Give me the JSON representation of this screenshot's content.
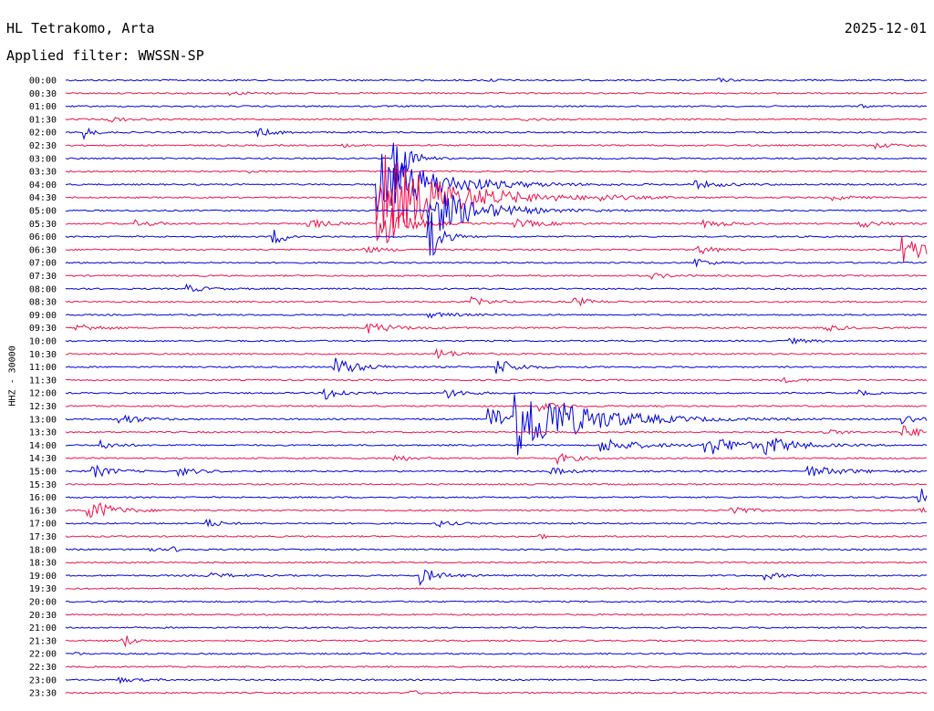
{
  "header": {
    "station": "HL Tetrakomo, Arta",
    "date": "2025-12-01",
    "filter": "Applied filter: WWSSN-SP",
    "channel_scale": "HHZ - 30000"
  },
  "colors": {
    "even": "#0000dd",
    "odd": "#f0104a"
  },
  "chart_data": {
    "type": "line",
    "title": "HL Tetrakomo, Arta",
    "subtitle": "Applied filter: WWSSN-SP",
    "ylabel": "HHZ - 30000",
    "row_labels": [
      "00:00",
      "00:30",
      "01:00",
      "01:30",
      "02:00",
      "02:30",
      "03:00",
      "03:30",
      "04:00",
      "04:30",
      "05:00",
      "05:30",
      "06:00",
      "06:30",
      "07:00",
      "07:30",
      "08:00",
      "08:30",
      "09:00",
      "09:30",
      "10:00",
      "10:30",
      "11:00",
      "11:30",
      "12:00",
      "12:30",
      "13:00",
      "13:30",
      "14:00",
      "14:30",
      "15:00",
      "15:30",
      "16:00",
      "16:30",
      "17:00",
      "17:30",
      "18:00",
      "18:30",
      "19:00",
      "19:30",
      "20:00",
      "20:30",
      "21:00",
      "21:30",
      "22:00",
      "22:30",
      "23:00",
      "23:30"
    ],
    "events": [
      {
        "row": 0,
        "t": 0.49,
        "a": 2,
        "d": 0.01
      },
      {
        "row": 0,
        "t": 0.755,
        "a": 2,
        "d": 0.015
      },
      {
        "row": 1,
        "t": 0.19,
        "a": 1.5,
        "d": 0.03
      },
      {
        "row": 2,
        "t": 0.92,
        "a": 2,
        "d": 0.01
      },
      {
        "row": 3,
        "t": 0.05,
        "a": 3,
        "d": 0.02
      },
      {
        "row": 3,
        "t": 0.53,
        "a": 2,
        "d": 0.02
      },
      {
        "row": 4,
        "t": 0.02,
        "a": 8,
        "d": 0.01
      },
      {
        "row": 4,
        "t": 0.22,
        "a": 5,
        "d": 0.02
      },
      {
        "row": 5,
        "t": 0.32,
        "a": 2,
        "d": 0.015
      },
      {
        "row": 5,
        "t": 0.94,
        "a": 3,
        "d": 0.02
      },
      {
        "row": 6,
        "t": 0.38,
        "a": 60,
        "d": 0.012
      },
      {
        "row": 7,
        "t": 0.21,
        "a": 2,
        "d": 0.01
      },
      {
        "row": 8,
        "t": 0.36,
        "a": 40,
        "d": 0.06
      },
      {
        "row": 8,
        "t": 0.73,
        "a": 4,
        "d": 0.03
      },
      {
        "row": 9,
        "t": 0.36,
        "a": 55,
        "d": 0.07
      },
      {
        "row": 9,
        "t": 0.62,
        "a": 3,
        "d": 0.02
      },
      {
        "row": 9,
        "t": 0.89,
        "a": 3,
        "d": 0.02
      },
      {
        "row": 10,
        "t": 0.42,
        "a": 30,
        "d": 0.05
      },
      {
        "row": 11,
        "t": 0.08,
        "a": 4,
        "d": 0.02
      },
      {
        "row": 11,
        "t": 0.28,
        "a": 6,
        "d": 0.02
      },
      {
        "row": 11,
        "t": 0.36,
        "a": 55,
        "d": 0.02
      },
      {
        "row": 11,
        "t": 0.52,
        "a": 5,
        "d": 0.03
      },
      {
        "row": 11,
        "t": 0.74,
        "a": 5,
        "d": 0.02
      },
      {
        "row": 11,
        "t": 0.92,
        "a": 5,
        "d": 0.02
      },
      {
        "row": 12,
        "t": 0.24,
        "a": 10,
        "d": 0.015
      },
      {
        "row": 12,
        "t": 0.42,
        "a": 60,
        "d": 0.01
      },
      {
        "row": 13,
        "t": 0.34,
        "a": 5,
        "d": 0.02
      },
      {
        "row": 13,
        "t": 0.73,
        "a": 6,
        "d": 0.02
      },
      {
        "row": 13,
        "t": 0.97,
        "a": 18,
        "d": 0.03
      },
      {
        "row": 14,
        "t": 0.73,
        "a": 6,
        "d": 0.015
      },
      {
        "row": 15,
        "t": 0.68,
        "a": 3,
        "d": 0.02
      },
      {
        "row": 16,
        "t": 0.14,
        "a": 4,
        "d": 0.02
      },
      {
        "row": 17,
        "t": 0.47,
        "a": 5,
        "d": 0.02
      },
      {
        "row": 17,
        "t": 0.59,
        "a": 6,
        "d": 0.015
      },
      {
        "row": 18,
        "t": 0.42,
        "a": 3,
        "d": 0.03
      },
      {
        "row": 19,
        "t": 0.01,
        "a": 6,
        "d": 0.02
      },
      {
        "row": 19,
        "t": 0.35,
        "a": 6,
        "d": 0.03
      },
      {
        "row": 19,
        "t": 0.88,
        "a": 4,
        "d": 0.02
      },
      {
        "row": 20,
        "t": 0.84,
        "a": 3,
        "d": 0.02
      },
      {
        "row": 21,
        "t": 0.43,
        "a": 6,
        "d": 0.02
      },
      {
        "row": 22,
        "t": 0.31,
        "a": 12,
        "d": 0.025
      },
      {
        "row": 22,
        "t": 0.5,
        "a": 10,
        "d": 0.02
      },
      {
        "row": 23,
        "t": 0.83,
        "a": 3,
        "d": 0.02
      },
      {
        "row": 24,
        "t": 0.3,
        "a": 8,
        "d": 0.02
      },
      {
        "row": 24,
        "t": 0.44,
        "a": 6,
        "d": 0.02
      },
      {
        "row": 24,
        "t": 0.92,
        "a": 4,
        "d": 0.01
      },
      {
        "row": 25,
        "t": 0.55,
        "a": 5,
        "d": 0.02
      },
      {
        "row": 26,
        "t": 0.06,
        "a": 8,
        "d": 0.02
      },
      {
        "row": 26,
        "t": 0.49,
        "a": 14,
        "d": 0.04
      },
      {
        "row": 26,
        "t": 0.52,
        "a": 40,
        "d": 0.07
      },
      {
        "row": 26,
        "t": 0.97,
        "a": 6,
        "d": 0.02
      },
      {
        "row": 27,
        "t": 0.97,
        "a": 8,
        "d": 0.02
      },
      {
        "row": 27,
        "t": 0.88,
        "a": 3,
        "d": 0.02
      },
      {
        "row": 28,
        "t": 0.04,
        "a": 6,
        "d": 0.015
      },
      {
        "row": 28,
        "t": 0.62,
        "a": 8,
        "d": 0.04
      },
      {
        "row": 28,
        "t": 0.74,
        "a": 12,
        "d": 0.04
      },
      {
        "row": 28,
        "t": 0.81,
        "a": 10,
        "d": 0.03
      },
      {
        "row": 29,
        "t": 0.38,
        "a": 4,
        "d": 0.02
      },
      {
        "row": 29,
        "t": 0.57,
        "a": 6,
        "d": 0.02
      },
      {
        "row": 30,
        "t": 0.03,
        "a": 8,
        "d": 0.02
      },
      {
        "row": 30,
        "t": 0.13,
        "a": 5,
        "d": 0.02
      },
      {
        "row": 30,
        "t": 0.56,
        "a": 5,
        "d": 0.02
      },
      {
        "row": 30,
        "t": 0.86,
        "a": 6,
        "d": 0.04
      },
      {
        "row": 32,
        "t": 0.99,
        "a": 14,
        "d": 0.01
      },
      {
        "row": 33,
        "t": 0.025,
        "a": 14,
        "d": 0.025
      },
      {
        "row": 33,
        "t": 0.77,
        "a": 8,
        "d": 0.015
      },
      {
        "row": 33,
        "t": 0.99,
        "a": 4,
        "d": 0.01
      },
      {
        "row": 34,
        "t": 0.16,
        "a": 6,
        "d": 0.015
      },
      {
        "row": 34,
        "t": 0.43,
        "a": 4,
        "d": 0.015
      },
      {
        "row": 35,
        "t": 0.55,
        "a": 4,
        "d": 0.005
      },
      {
        "row": 36,
        "t": 0.09,
        "a": 4,
        "d": 0.01
      },
      {
        "row": 36,
        "t": 0.12,
        "a": 4,
        "d": 0.01
      },
      {
        "row": 38,
        "t": 0.16,
        "a": 3,
        "d": 0.03
      },
      {
        "row": 38,
        "t": 0.41,
        "a": 10,
        "d": 0.02
      },
      {
        "row": 38,
        "t": 0.81,
        "a": 5,
        "d": 0.015
      },
      {
        "row": 43,
        "t": 0.065,
        "a": 10,
        "d": 0.01
      },
      {
        "row": 44,
        "t": 0.01,
        "a": 3,
        "d": 0.005
      },
      {
        "row": 45,
        "t": 0.6,
        "a": 3,
        "d": 0.005
      },
      {
        "row": 46,
        "t": 0.06,
        "a": 3,
        "d": 0.02
      },
      {
        "row": 47,
        "t": 0.4,
        "a": 3,
        "d": 0.01
      }
    ]
  }
}
